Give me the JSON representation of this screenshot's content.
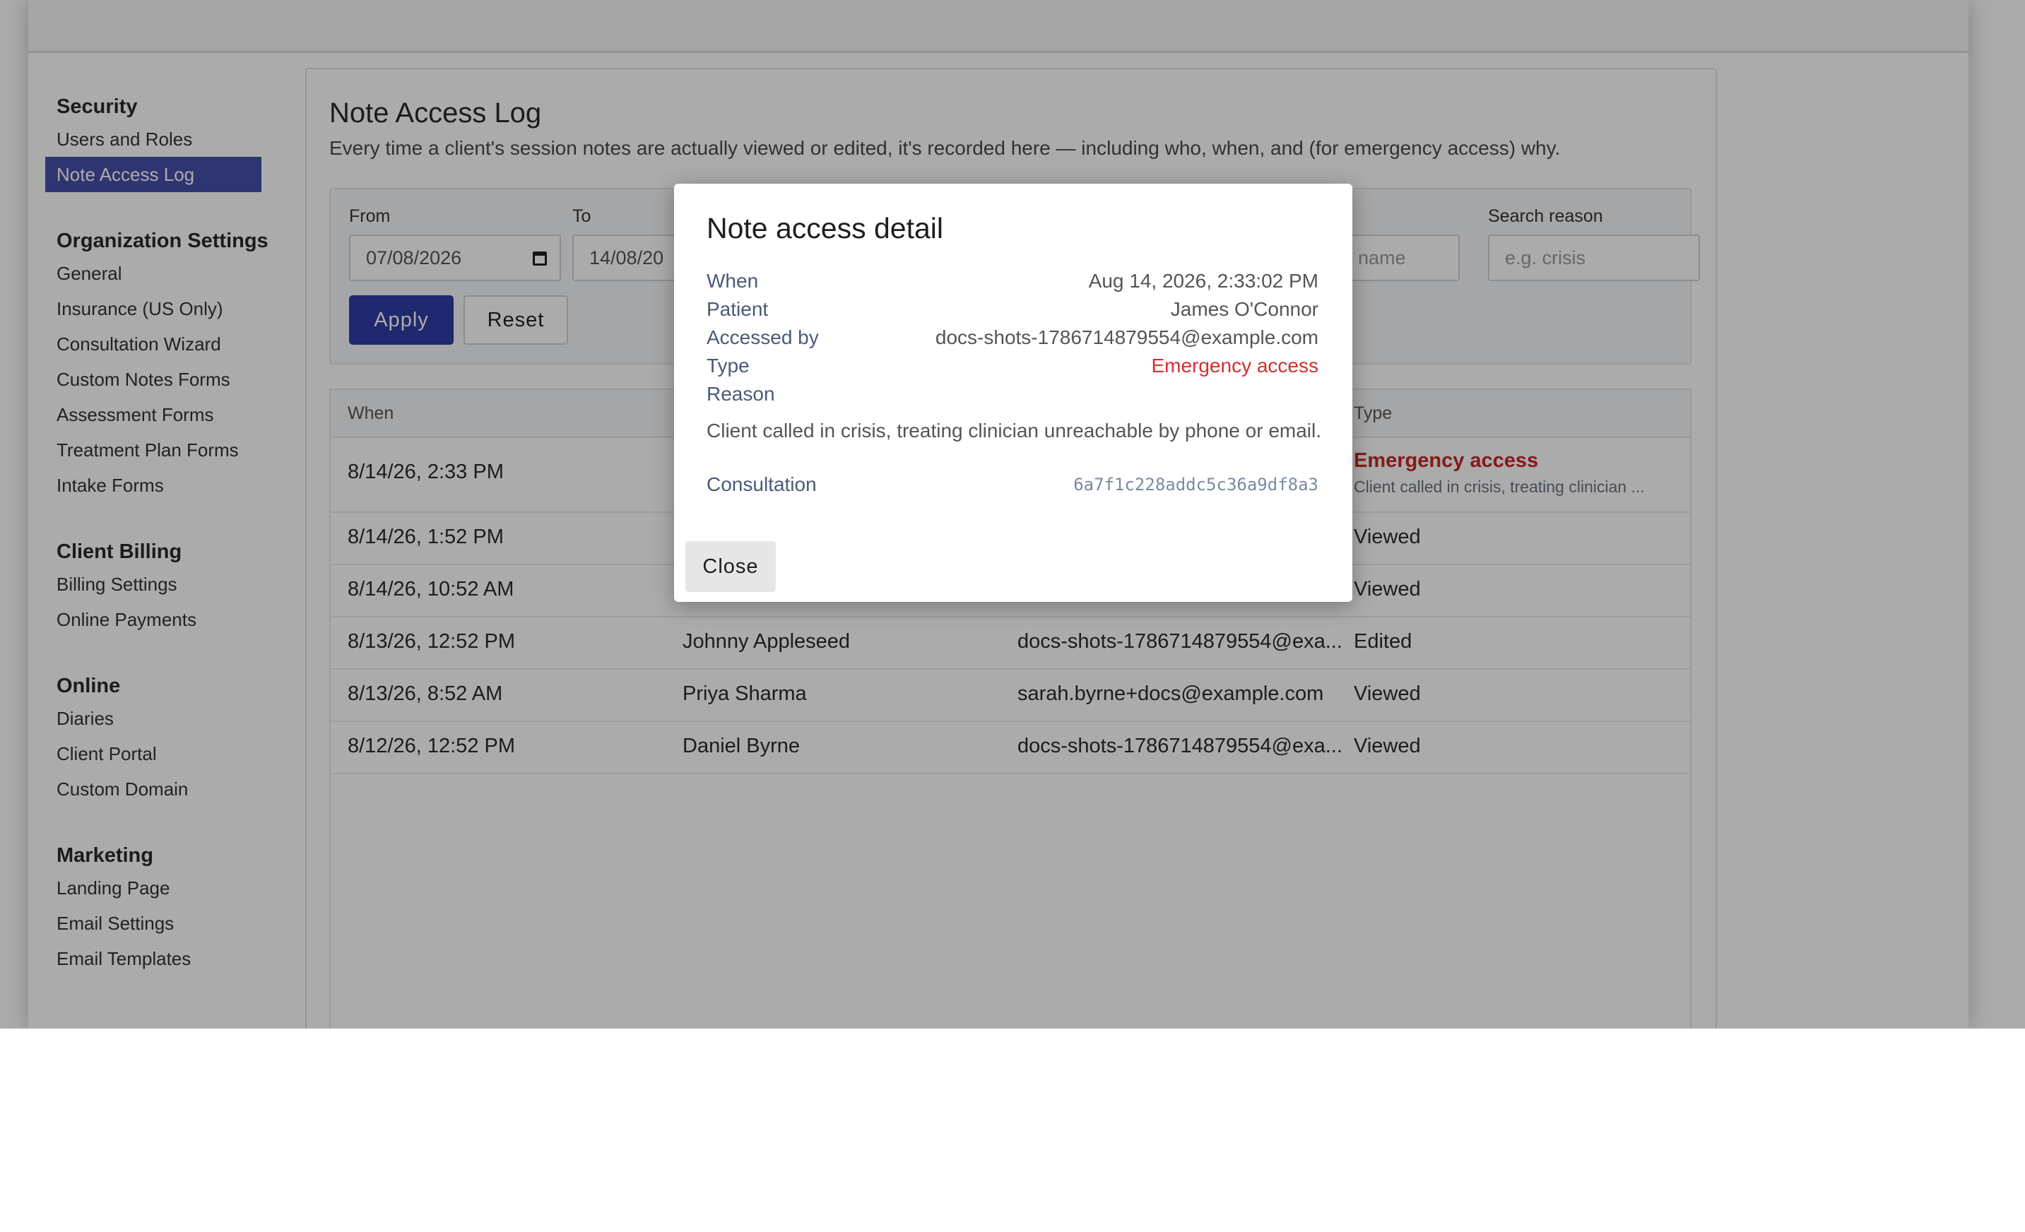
{
  "sidebar": {
    "groups": [
      {
        "title": "Security",
        "items": [
          "Users and Roles",
          "Note Access Log"
        ]
      },
      {
        "title": "Organization Settings",
        "items": [
          "General",
          "Insurance (US Only)",
          "Consultation Wizard",
          "Custom Notes Forms",
          "Assessment Forms",
          "Treatment Plan Forms",
          "Intake Forms"
        ]
      },
      {
        "title": "Client Billing",
        "items": [
          "Billing Settings",
          "Online Payments"
        ]
      },
      {
        "title": "Online",
        "items": [
          "Diaries",
          "Client Portal",
          "Custom Domain"
        ]
      },
      {
        "title": "Marketing",
        "items": [
          "Landing Page",
          "Email Settings",
          "Email Templates"
        ]
      }
    ],
    "active_item": "Note Access Log"
  },
  "page": {
    "title": "Note Access Log",
    "description": "Every time a client's session notes are actually viewed or edited, it's recorded here — including who, when, and (for emergency access) why."
  },
  "filters": {
    "from_label": "From",
    "from_value": "07/08/2026",
    "to_label": "To",
    "to_value": "14/08/20",
    "name_placeholder": "name",
    "search_reason_label": "Search reason",
    "search_reason_placeholder": "e.g. crisis",
    "apply_label": "Apply",
    "reset_label": "Reset"
  },
  "table": {
    "headers": {
      "when": "When",
      "type": "Type"
    },
    "rows": [
      {
        "when": "8/14/26, 2:33 PM",
        "patient": "",
        "accessed_by": "",
        "type": "Emergency access",
        "reason": "Client called in crisis, treating clinician ..."
      },
      {
        "when": "8/14/26, 1:52 PM",
        "patient": "",
        "accessed_by": "",
        "type": "Viewed"
      },
      {
        "when": "8/14/26, 10:52 AM",
        "patient": "",
        "accessed_by": "",
        "type": "Viewed"
      },
      {
        "when": "8/13/26, 12:52 PM",
        "patient": "Johnny Appleseed",
        "accessed_by": "docs-shots-1786714879554@exa...",
        "type": "Edited"
      },
      {
        "when": "8/13/26, 8:52 AM",
        "patient": "Priya Sharma",
        "accessed_by": "sarah.byrne+docs@example.com",
        "type": "Viewed"
      },
      {
        "when": "8/12/26, 12:52 PM",
        "patient": "Daniel Byrne",
        "accessed_by": "docs-shots-1786714879554@exa...",
        "type": "Viewed"
      }
    ]
  },
  "modal": {
    "title": "Note access detail",
    "when_label": "When",
    "when_value": "Aug 14, 2026, 2:33:02 PM",
    "patient_label": "Patient",
    "patient_value": "James O'Connor",
    "accessed_by_label": "Accessed by",
    "accessed_by_value": "docs-shots-1786714879554@example.com",
    "type_label": "Type",
    "type_value": "Emergency access",
    "reason_label": "Reason",
    "reason_value": "Client called in crisis, treating clinician unreachable by phone or email.",
    "consultation_label": "Consultation",
    "consultation_value": "6a7f1c228addc5c36a9df8a3",
    "close_label": "Close"
  },
  "colors": {
    "accent": "#2f3ca8",
    "sidebar_active": "#4650a8",
    "emergency": "#d32f2f"
  },
  "icons": {
    "date_picker": "calendar-icon"
  }
}
